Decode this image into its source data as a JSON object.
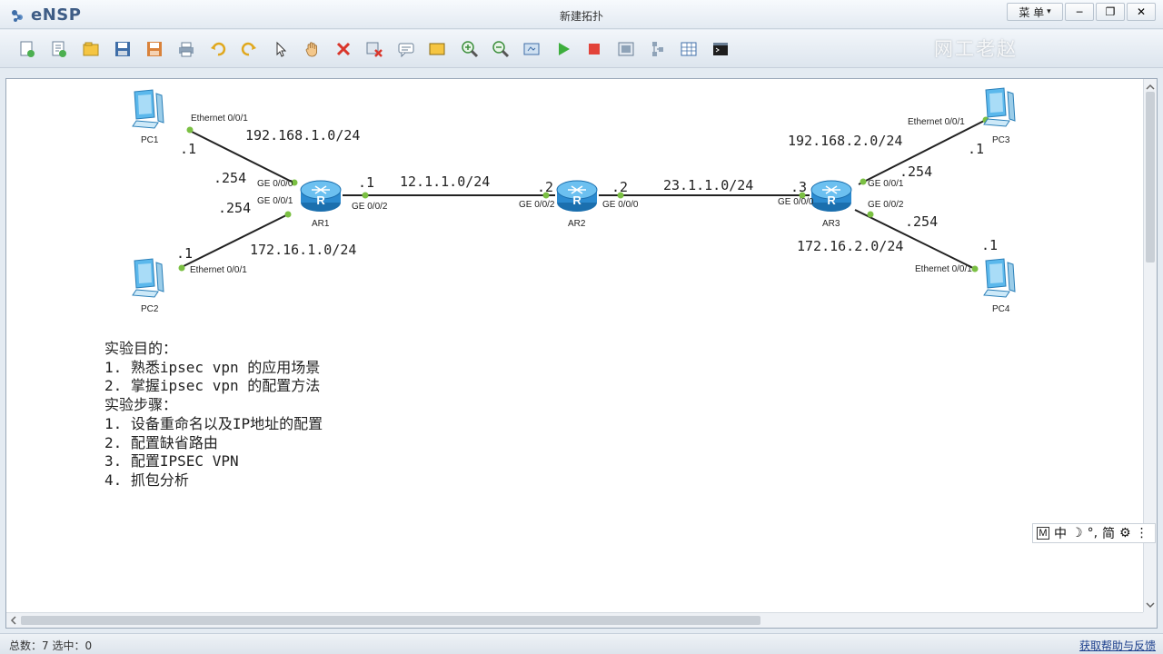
{
  "app": {
    "name": "eNSP",
    "document_title": "新建拓扑"
  },
  "window_controls": {
    "menu_label": "菜 单",
    "menu_arrow": "▾",
    "minimize": "─",
    "restore": "❐",
    "close": "✕"
  },
  "watermark": "网工老赵",
  "toolbar": {
    "tools": [
      "new-topology-icon",
      "new-lab-icon",
      "open-icon",
      "save-icon",
      "save-as-icon",
      "print-icon",
      "undo-icon",
      "redo-icon",
      "select-icon",
      "pan-hand-icon",
      "delete-icon",
      "delete-links-icon",
      "text-note-icon",
      "rectangle-icon",
      "zoom-in-icon",
      "zoom-out-icon",
      "fit-view-icon",
      "start-device-icon",
      "stop-device-icon",
      "capture-icon",
      "topology-icon",
      "grid-icon",
      "console-icon"
    ]
  },
  "topology": {
    "devices": {
      "pc1": {
        "label": "PC1"
      },
      "pc2": {
        "label": "PC2"
      },
      "pc3": {
        "label": "PC3"
      },
      "pc4": {
        "label": "PC4"
      },
      "ar1": {
        "label": "AR1"
      },
      "ar2": {
        "label": "AR2"
      },
      "ar3": {
        "label": "AR3"
      }
    },
    "interfaces": {
      "pc1_eth": "Ethernet 0/0/1",
      "pc2_eth": "Ethernet 0/0/1",
      "pc3_eth": "Ethernet 0/0/1",
      "pc4_eth": "Ethernet 0/0/1",
      "ar1_g000": "GE 0/0/0",
      "ar1_g001": "GE 0/0/1",
      "ar1_g002": "GE 0/0/2",
      "ar2_g002": "GE 0/0/2",
      "ar2_g000": "GE 0/0/0",
      "ar3_g000": "GE 0/0/0",
      "ar3_g001": "GE 0/0/1",
      "ar3_g002": "GE 0/0/2"
    },
    "networks": {
      "net_pc1": "192.168.1.0/24",
      "net_pc2": "172.16.1.0/24",
      "net_ar1_ar2": "12.1.1.0/24",
      "net_ar2_ar3": "23.1.1.0/24",
      "net_pc3": "192.168.2.0/24",
      "net_pc4": "172.16.2.0/24"
    },
    "hosts": {
      "pc1_ip": ".1",
      "ar1_to_pc1": ".254",
      "ar1_to_pc2": ".254",
      "pc2_ip": ".1",
      "ar1_wan": ".1",
      "ar2_to_ar1": ".2",
      "ar2_to_ar3": ".2",
      "ar3_wan": ".3",
      "ar3_to_pc3": ".254",
      "ar3_to_pc4": ".254",
      "pc3_ip": ".1",
      "pc4_ip": ".1"
    }
  },
  "notes": [
    "实验目的：",
    "1. 熟悉ipsec vpn 的应用场景",
    "2. 掌握ipsec vpn 的配置方法",
    "实验步骤：",
    "1. 设备重命名以及IP地址的配置",
    "2. 配置缺省路由",
    "3. 配置IPSEC VPN",
    "4. 抓包分析"
  ],
  "ime": {
    "mode": "M",
    "lang": "中",
    "moon": "☽",
    "punct": "°,",
    "script": "简",
    "gear": "⚙",
    "more": "⋮"
  },
  "status": {
    "left": "总数：7 选中：0",
    "help_link": "获取帮助与反馈"
  },
  "colors": {
    "link": "#1a3e8c",
    "router": "#2c8bd0",
    "link_dot": "#7bc043"
  }
}
